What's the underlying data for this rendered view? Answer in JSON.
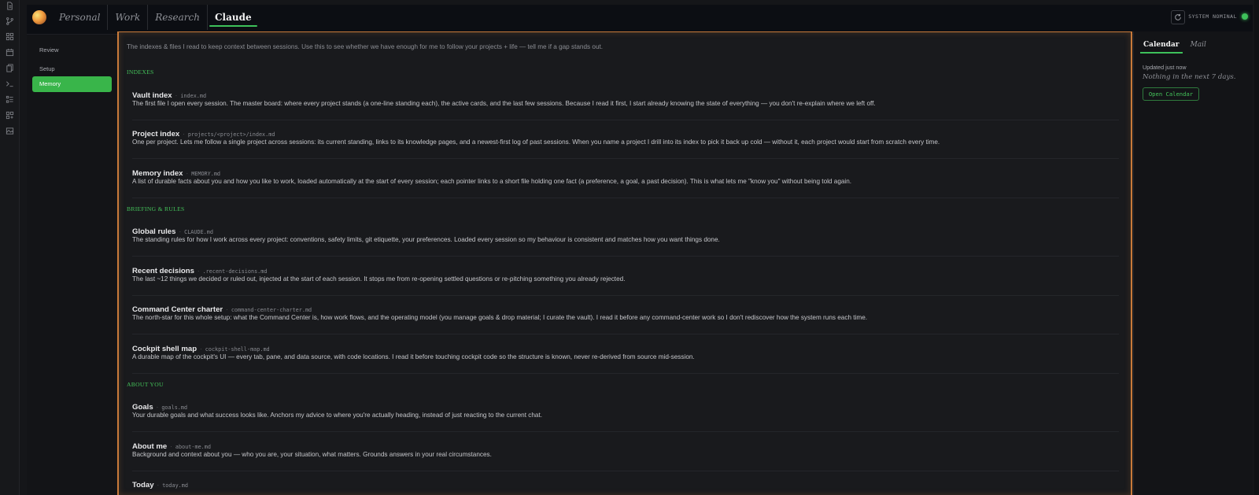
{
  "header": {
    "tabs": [
      {
        "label": "Personal",
        "active": false
      },
      {
        "label": "Work",
        "active": false
      },
      {
        "label": "Research",
        "active": false
      },
      {
        "label": "Claude",
        "active": true
      }
    ],
    "status_text": "SYSTEM NOMINAL",
    "status_color": "#3ec15a"
  },
  "rail_icons": [
    "document-icon",
    "branch-icon",
    "grid-icon",
    "calendar-icon",
    "files-icon",
    "terminal-icon",
    "list-icon",
    "apps-icon",
    "image-icon"
  ],
  "sidenav": {
    "items": [
      {
        "label": "Review",
        "active": false
      },
      {
        "label": "Setup",
        "active": false
      },
      {
        "label": "Memory",
        "active": true
      }
    ]
  },
  "main": {
    "intro": "The indexes & files I read to keep context between sessions. Use this to see whether we have enough for me to follow your projects + life — tell me if a gap stands out.",
    "sections": [
      {
        "heading": "INDEXES",
        "items": [
          {
            "title": "Vault index",
            "file": "index.md",
            "desc": "The first file I open every session. The master board: where every project stands (a one-line standing each), the active cards, and the last few sessions. Because I read it first, I start already knowing the state of everything — you don't re-explain where we left off."
          },
          {
            "title": "Project index",
            "file": "projects/<project>/index.md",
            "desc": "One per project. Lets me follow a single project across sessions: its current standing, links to its knowledge pages, and a newest-first log of past sessions. When you name a project I drill into its index to pick it back up cold — without it, each project would start from scratch every time."
          },
          {
            "title": "Memory index",
            "file": "MEMORY.md",
            "desc": "A list of durable facts about you and how you like to work, loaded automatically at the start of every session; each pointer links to a short file holding one fact (a preference, a goal, a past decision). This is what lets me \"know you\" without being told again."
          }
        ]
      },
      {
        "heading": "BRIEFING & RULES",
        "items": [
          {
            "title": "Global rules",
            "file": "CLAUDE.md",
            "desc": "The standing rules for how I work across every project: conventions, safety limits, git etiquette, your preferences. Loaded every session so my behaviour is consistent and matches how you want things done."
          },
          {
            "title": "Recent decisions",
            "file": ".recent-decisions.md",
            "desc": "The last ~12 things we decided or ruled out, injected at the start of each session. It stops me from re-opening settled questions or re-pitching something you already rejected."
          },
          {
            "title": "Command Center charter",
            "file": "command-center-charter.md",
            "desc": "The north-star for this whole setup: what the Command Center is, how work flows, and the operating model (you manage goals & drop material; I curate the vault). I read it before any command-center work so I don't rediscover how the system runs each time."
          },
          {
            "title": "Cockpit shell map",
            "file": "cockpit-shell-map.md",
            "desc": "A durable map of the cockpit's UI — every tab, pane, and data source, with code locations. I read it before touching cockpit code so the structure is known, never re-derived from source mid-session."
          }
        ]
      },
      {
        "heading": "ABOUT YOU",
        "items": [
          {
            "title": "Goals",
            "file": "goals.md",
            "desc": "Your durable goals and what success looks like. Anchors my advice to where you're actually heading, instead of just reacting to the current chat."
          },
          {
            "title": "About me",
            "file": "about-me.md",
            "desc": "Background and context about you — who you are, your situation, what matters. Grounds answers in your real circumstances."
          },
          {
            "title": "Today",
            "file": "today.md",
            "desc": ""
          }
        ]
      }
    ]
  },
  "rpanel": {
    "tabs": [
      {
        "label": "Calendar",
        "active": true
      },
      {
        "label": "Mail",
        "active": false
      }
    ],
    "updated": "Updated just now",
    "empty_text": "Nothing in the next 7 days.",
    "open_button": "Open Calendar"
  }
}
